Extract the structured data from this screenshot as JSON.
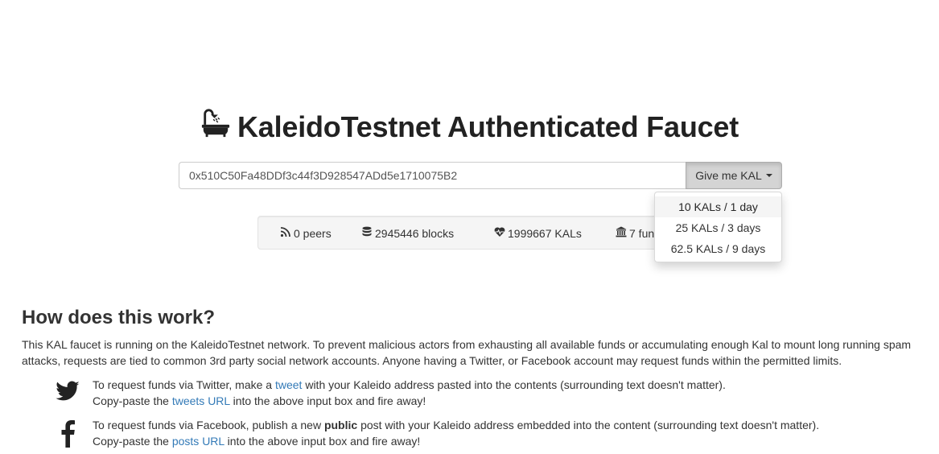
{
  "title": "KaleidoTestnet Authenticated Faucet",
  "address": {
    "value": "0x510C50Fa48DDf3c44f3D928547ADd5e1710075B2",
    "button_label": "Give me KAL"
  },
  "dropdown": {
    "items": [
      "10 KALs / 1 day",
      "25 KALs / 3 days",
      "62.5 KALs / 9 days"
    ]
  },
  "stats": {
    "peers": "0 peers",
    "blocks": "2945446 blocks",
    "kals": "1999667 KALs",
    "funded": "7 funded"
  },
  "how": {
    "title": "How does this work?",
    "text": "This KAL faucet is running on the KaleidoTestnet network. To prevent malicious actors from exhausting all available funds or accumulating enough Kal to mount long running spam attacks, requests are tied to common 3rd party social network accounts. Anyone having a Twitter, or Facebook account may request funds within the permitted limits."
  },
  "twitter": {
    "line1_pre": "To request funds via Twitter, make a ",
    "line1_link": "tweet",
    "line1_post": " with your Kaleido address pasted into the contents (surrounding text doesn't matter).",
    "line2_pre": "Copy-paste the ",
    "line2_link": "tweets URL",
    "line2_post": " into the above input box and fire away!"
  },
  "facebook": {
    "line1_pre": "To request funds via Facebook, publish a new ",
    "line1_bold": "public",
    "line1_post": " post with your Kaleido address embedded into the content (surrounding text doesn't matter).",
    "line2_pre": "Copy-paste the ",
    "line2_link": "posts URL",
    "line2_post": " into the above input box and fire away!"
  },
  "colors": {
    "link": "#337ab7",
    "text": "#333333",
    "button_bg": "#d4d4d4"
  }
}
